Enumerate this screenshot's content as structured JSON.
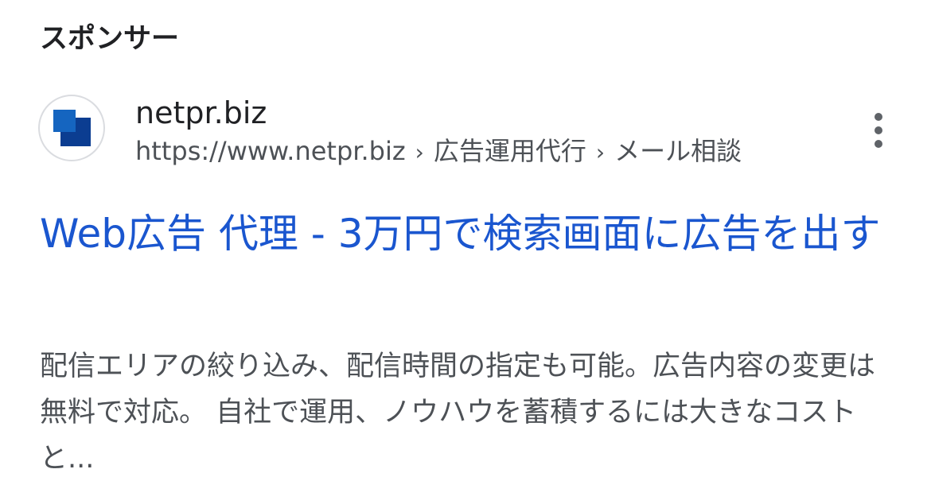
{
  "sponsored_label": "スポンサー",
  "ad": {
    "site_name": "netpr.biz",
    "url": "https://www.netpr.biz",
    "breadcrumbs": [
      "広告運用代行",
      "メール相談"
    ],
    "breadcrumb_separator": "›",
    "title": "Web広告 代理 - 3万円で検索画面に広告を出す",
    "description": "配信エリアの絞り込み、配信時間の指定も可能。広告内容の変更は無料で対応。 自社で運用、ノウハウを蓄積するには大きなコストと...",
    "favicon_icon": "blue-square-logo-icon",
    "more_icon": "more-vert-icon"
  },
  "colors": {
    "title_link": "#1a56cf",
    "text_primary": "#202124",
    "text_secondary": "#4d5156",
    "favicon_dark": "#0b3d91",
    "favicon_light": "#1565c0"
  }
}
